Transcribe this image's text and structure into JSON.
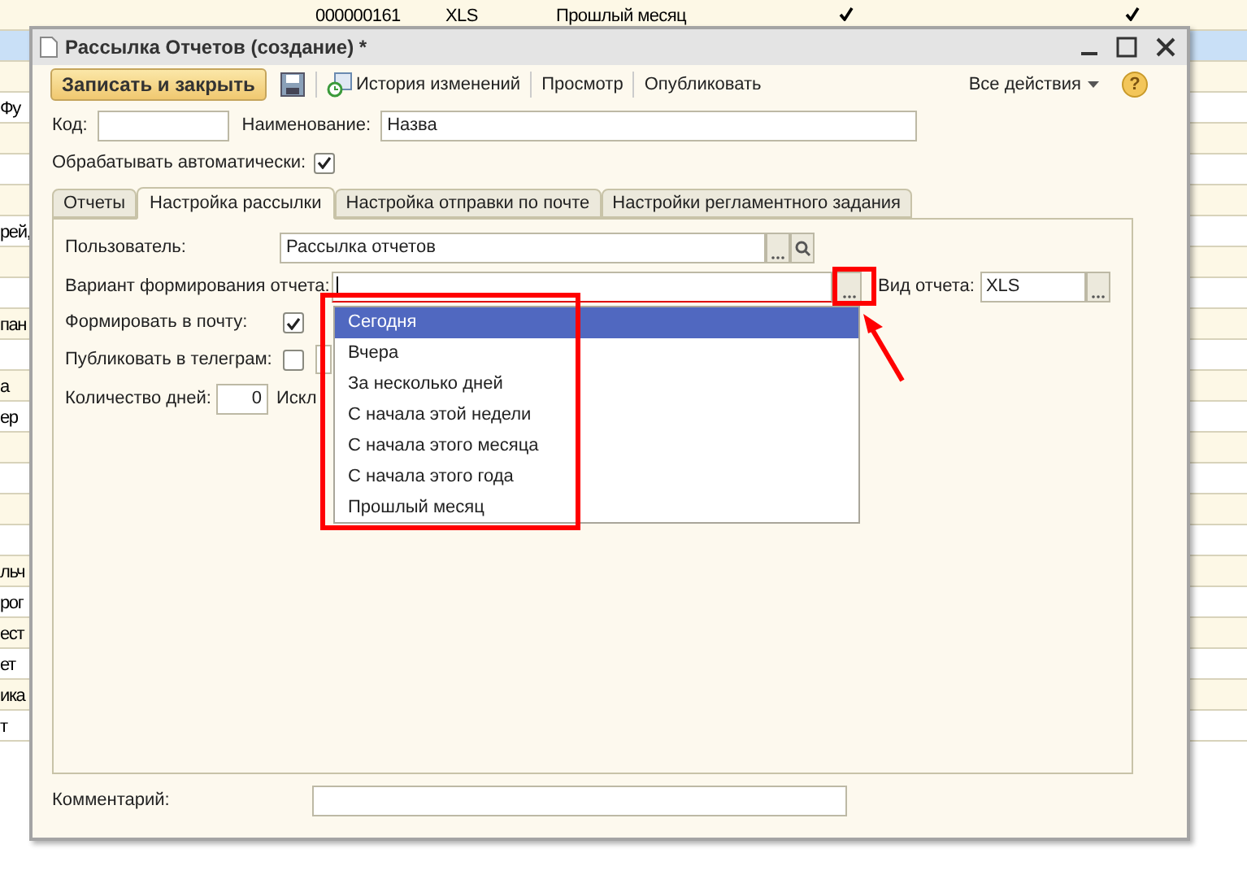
{
  "background_table": {
    "rows": [
      {
        "selected": false,
        "column_2": "000000161",
        "column_3": "XLS",
        "column_4": "Прошлый месяц",
        "column_5": true,
        "column_6": true
      },
      {
        "selected": true
      },
      {
        "selected": false
      },
      {
        "selected": false,
        "column_1": "Фу"
      },
      {
        "selected": false
      },
      {
        "selected": false
      },
      {
        "selected": false
      },
      {
        "selected": false,
        "column_1": "рей,"
      },
      {
        "selected": false
      },
      {
        "selected": false
      },
      {
        "selected": false,
        "column_1": "пан"
      },
      {
        "selected": false
      },
      {
        "selected": false,
        "column_1": "а"
      },
      {
        "selected": false,
        "column_1": "ер"
      },
      {
        "selected": false
      },
      {
        "selected": false
      },
      {
        "selected": false
      },
      {
        "selected": false
      },
      {
        "selected": false,
        "column_1": "льч"
      },
      {
        "selected": false,
        "column_1": "рог"
      },
      {
        "selected": false,
        "column_1": "ест"
      },
      {
        "selected": false,
        "column_1": "ет"
      },
      {
        "selected": false,
        "column_1": "ика"
      },
      {
        "selected": false,
        "column_1": "т"
      }
    ]
  },
  "window": {
    "title": "Рассылка Отчетов (создание) *",
    "toolbar": {
      "save_close": "Записать и закрыть",
      "history": "История изменений",
      "preview": "Просмотр",
      "publish": "Опубликовать",
      "all_actions": "Все действия",
      "help": "?"
    },
    "code": {
      "label": "Код:"
    },
    "name": {
      "label": "Наименование:",
      "value": "Назва"
    },
    "auto_process": {
      "label": "Обрабатывать автоматически:",
      "checked": true
    },
    "tabs": [
      {
        "label": "Отчеты",
        "selected": false
      },
      {
        "label": "Настройка рассылки",
        "selected": true
      },
      {
        "label": "Настройка отправки по почте",
        "selected": false
      },
      {
        "label": "Настройки регламентного задания",
        "selected": false
      }
    ],
    "user": {
      "label": "Пользователь:",
      "value": "Рассылка отчетов"
    },
    "variant": {
      "label": "Вариант формирования отчета:"
    },
    "report_type": {
      "label": "Вид отчета:",
      "value": "XLS"
    },
    "to_mail": {
      "label": "Формировать в почту:",
      "checked": true
    },
    "to_telegram": {
      "label": "Публиковать в телеграм:",
      "checked": false
    },
    "days": {
      "label": "Количество дней:",
      "value": "0"
    },
    "exclude_label": "Искл",
    "dropdown": [
      {
        "label": "Сегодня",
        "selected": true
      },
      {
        "label": "Вчера",
        "selected": false
      },
      {
        "label": "За несколько дней",
        "selected": false
      },
      {
        "label": "С начала этой недели",
        "selected": false
      },
      {
        "label": "С начала этого месяца",
        "selected": false
      },
      {
        "label": "С начала этого года",
        "selected": false
      },
      {
        "label": "Прошлый месяц",
        "selected": false
      }
    ],
    "comment": {
      "label": "Комментарий:"
    }
  },
  "annotations": [
    {
      "kind": "frame"
    },
    {
      "kind": "frame"
    },
    {
      "kind": "arrow"
    }
  ]
}
